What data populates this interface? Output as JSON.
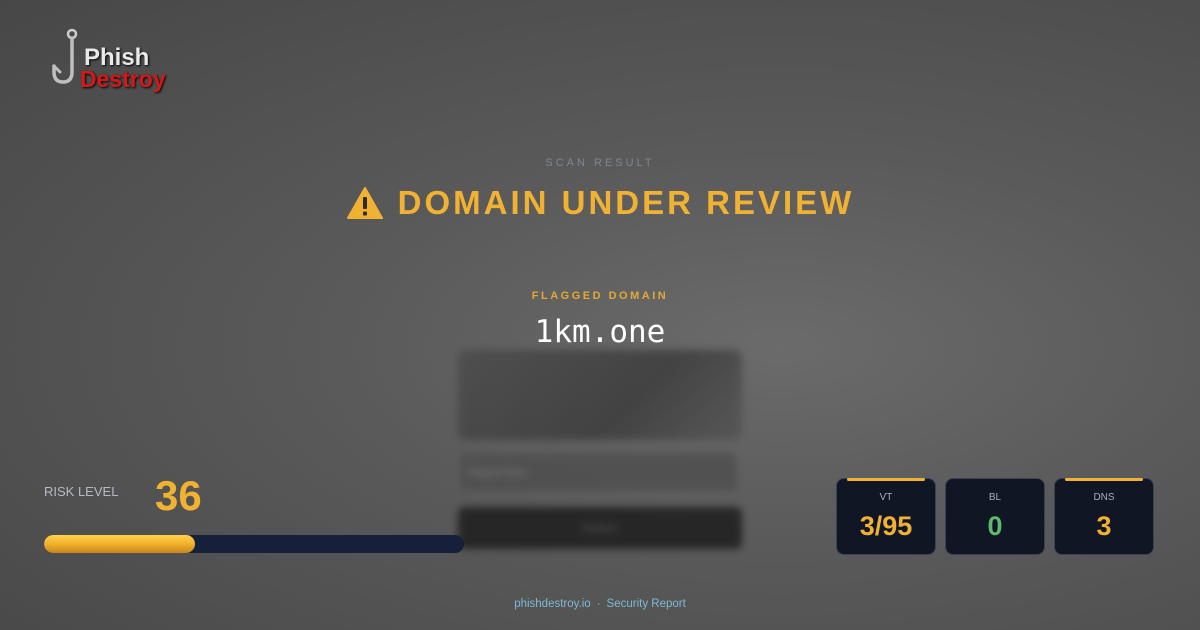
{
  "logo": {
    "word1": "Phish",
    "word2": "Destroy",
    "icon": "fishhook-icon"
  },
  "scan": {
    "label": "SCAN RESULT",
    "headline": "DOMAIN UNDER REVIEW",
    "headline_icon": "warning-icon",
    "headline_color": "#f1b233"
  },
  "flagged": {
    "label": "FLAGGED DOMAIN",
    "domain": "1km.one"
  },
  "preview": {
    "input_placeholder": "Report form",
    "button_label": "Button"
  },
  "risk": {
    "label": "RISK LEVEL",
    "value": "36",
    "fill_percent": 36
  },
  "stats": [
    {
      "name": "VT",
      "value": "3/95",
      "color": "#f1b233",
      "highlight": true
    },
    {
      "name": "BL",
      "value": "0",
      "color": "#5fba6d",
      "highlight": false
    },
    {
      "name": "DNS",
      "value": "3",
      "color": "#f1b233",
      "highlight": true
    }
  ],
  "footer": {
    "site": "phishdestroy.io",
    "separator": "·",
    "report": "Security Report"
  }
}
